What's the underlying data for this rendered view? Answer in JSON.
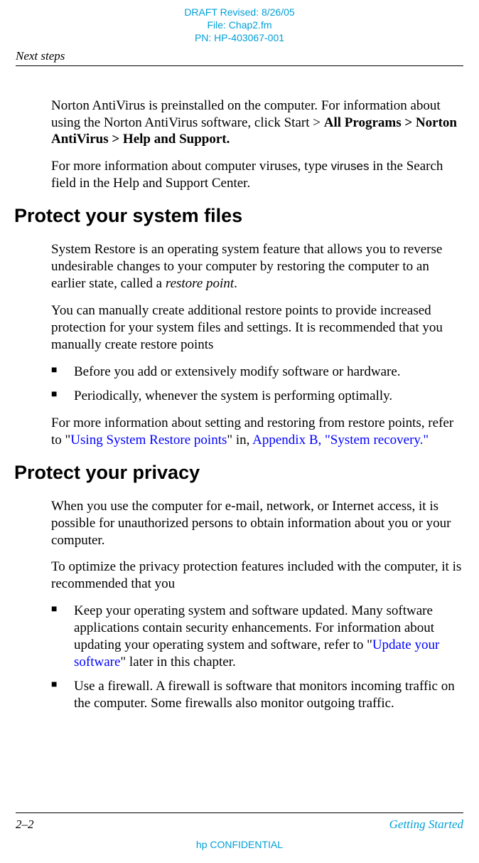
{
  "draft": {
    "line1": "DRAFT Revised: 8/26/05",
    "line2": "File: Chap2.fm",
    "line3": "PN: HP-403067-001"
  },
  "section_header": "Next steps",
  "para1_a": "Norton AntiVirus is preinstalled on the computer. For information about using the Norton AntiVirus software, click Start > ",
  "para1_b": "All Programs > Norton AntiVirus > Help and Support.",
  "para2_a": "For more information about computer viruses, type ",
  "para2_b": "viruses",
  "para2_c": " in the Search field in the Help and Support Center.",
  "heading1": "Protect your system files",
  "para3_a": "System Restore is an operating system feature that allows you to reverse undesirable changes to your computer by restoring the computer to an earlier state, called a ",
  "para3_b": "restore point",
  "para3_c": ".",
  "para4": "You can manually create additional restore points to provide increased protection for your system files and settings. It is recommended that you manually create restore points",
  "bullets1": {
    "item1": "Before you add or extensively modify software or hardware.",
    "item2": "Periodically, whenever the system is performing optimally."
  },
  "para5_a": "For more information about setting and restoring from restore points, refer to \"",
  "para5_link1": "Using System Restore points",
  "para5_b": "\" in, ",
  "para5_link2": "Appendix B, \"System recovery.\"",
  "heading2": "Protect your privacy",
  "para6": "When you use the computer for e-mail, network, or Internet access, it is possible for unauthorized persons to obtain information about you or your computer.",
  "para7": "To optimize the privacy protection features included with the computer, it is recommended that you",
  "bullets2": {
    "item1_a": "Keep your operating system and software updated. Many software applications contain security enhancements. For information about updating your operating system and software, refer to \"",
    "item1_link": "Update your software",
    "item1_b": "\" later in this chapter.",
    "item2": "Use a firewall. A firewall is software that monitors incoming traffic on the computer. Some firewalls also monitor outgoing traffic."
  },
  "footer": {
    "page": "2–2",
    "title": "Getting Started",
    "confidential": "hp CONFIDENTIAL"
  }
}
